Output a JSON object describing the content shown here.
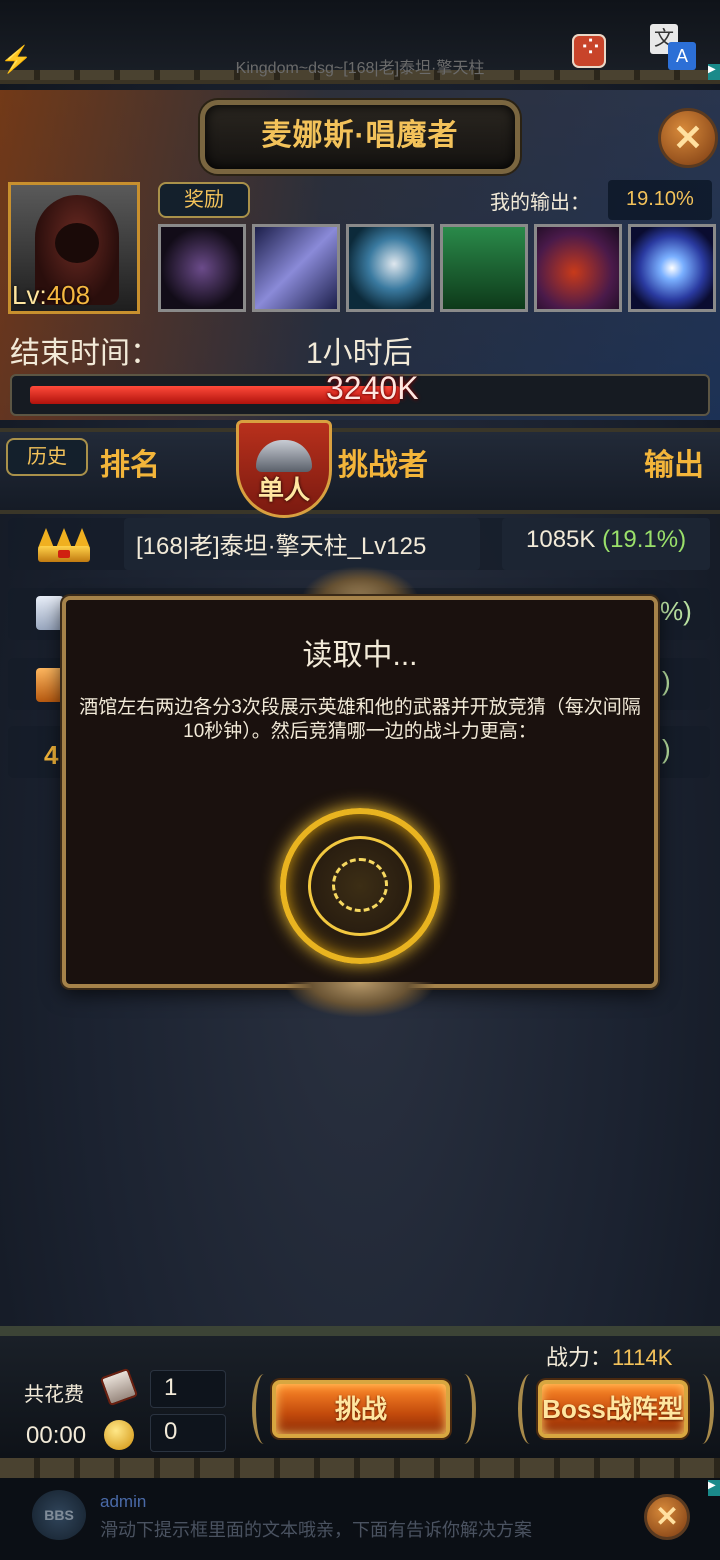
{
  "topbar": {
    "window_title": "Kingdom~dsg~[168|老]泰坦·擎天柱",
    "translate_glyph_a": "文",
    "translate_glyph_b": "A"
  },
  "boss": {
    "name": "麦娜斯·唱魔者",
    "level_prefix": "Lv:",
    "level": "408",
    "reward_label": "奖励",
    "my_output_label": "我的输出：",
    "my_output_value": "19.10%",
    "end_time_label": "结束时间：",
    "end_time_value": "1小时后",
    "hp_text": "3240K",
    "hp_fraction": 0.56
  },
  "ranking": {
    "history_label": "历史",
    "col_rank": "排名",
    "mode_label": "单人",
    "col_challenger": "挑战者",
    "col_output": "输出",
    "rows": [
      {
        "name": "[168|老]泰坦·擎天柱_Lv125",
        "output": "1085K",
        "percent": "(19.1%)"
      }
    ],
    "partial_suffix_1": "%)",
    "partial_suffix_2": ")",
    "partial_suffix_3": ")"
  },
  "modal": {
    "title": "读取中...",
    "text": "酒馆左右两边各分3次段展示英雄和他的武器并开放竞猜（每次间隔10秒钟）。然后竞猜哪一边的战斗力更高："
  },
  "bottom": {
    "power_label": "战力：",
    "power_value": "1114K",
    "cost_label": "共花费",
    "cost_value": "1",
    "timer_value": "00:00",
    "coin_value": "0",
    "challenge_label": "挑战",
    "formation_label": "Boss战阵型"
  },
  "footer": {
    "bbs_label": "BBS",
    "user": "admin",
    "message": "滑动下提示框里面的文本哦亲，下面有告诉你解决方案"
  },
  "colors": {
    "accent_gold": "#f3c25a",
    "hp_red": "#d0201a",
    "percent_green": "#9ae06a"
  }
}
